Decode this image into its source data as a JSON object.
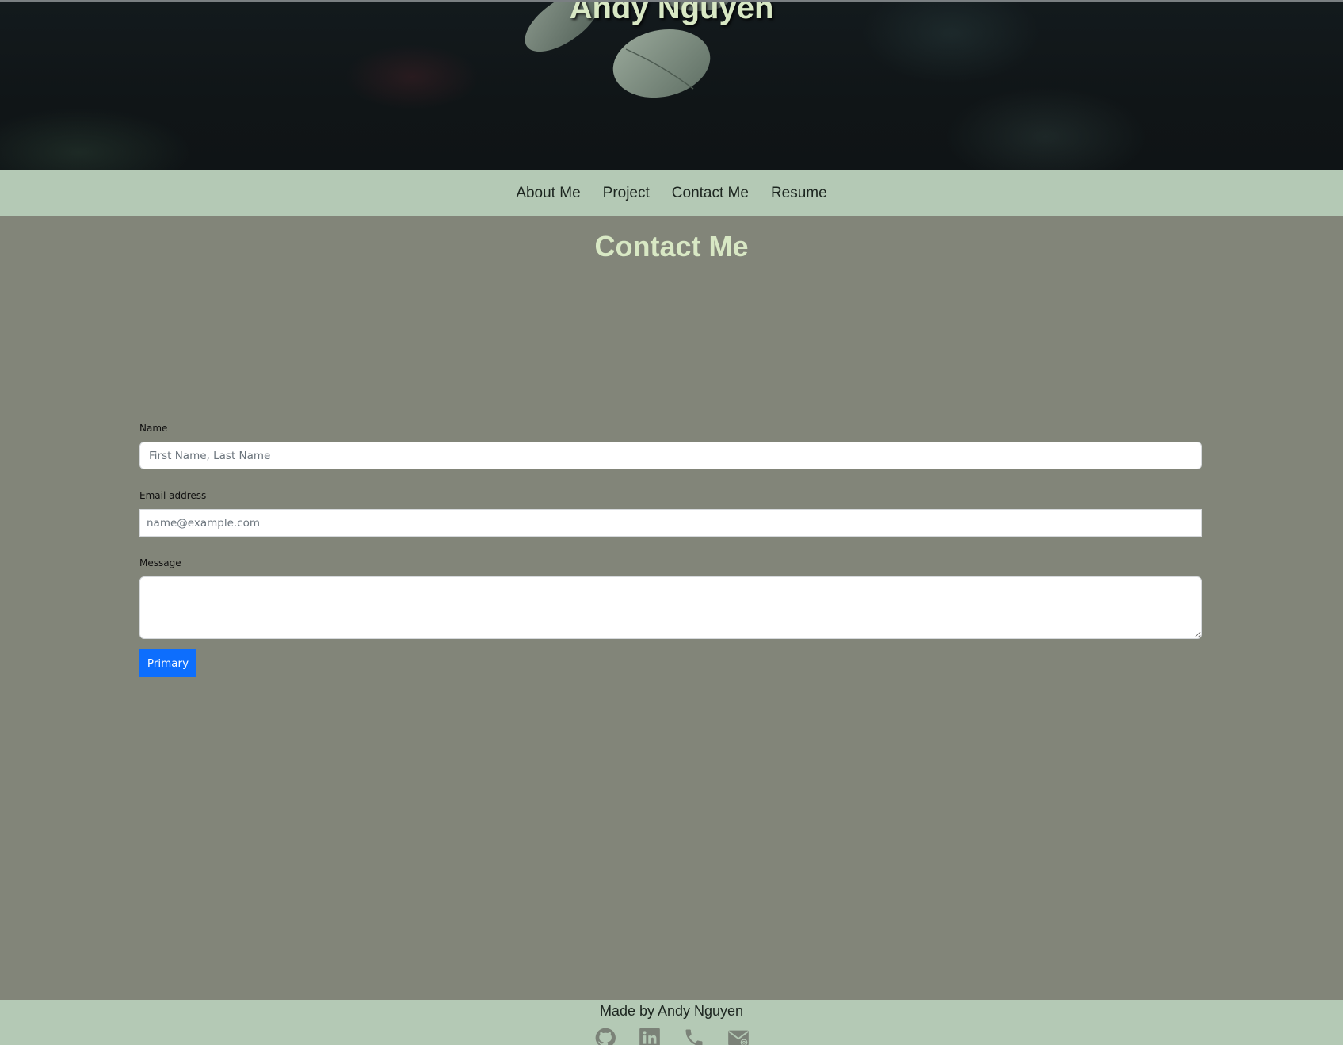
{
  "header": {
    "title": "Andy Nguyen"
  },
  "nav": {
    "items": [
      {
        "label": "About Me"
      },
      {
        "label": "Project"
      },
      {
        "label": "Contact Me"
      },
      {
        "label": "Resume"
      }
    ]
  },
  "contact": {
    "title": "Contact Me",
    "name_label": "Name",
    "name_placeholder": "First Name, Last Name",
    "name_value": "",
    "email_label": "Email address",
    "email_placeholder": "name@example.com",
    "email_value": "",
    "message_label": "Message",
    "message_value": "",
    "submit_label": "Primary"
  },
  "footer": {
    "text": "Made by Andy Nguyen",
    "icons": [
      "github-icon",
      "linkedin-icon",
      "phone-icon",
      "email-icon"
    ]
  },
  "colors": {
    "background": "#828579",
    "nav_background": "#b4c9b5",
    "title_color": "#d8e8c4",
    "primary_button": "#0d6efd"
  }
}
